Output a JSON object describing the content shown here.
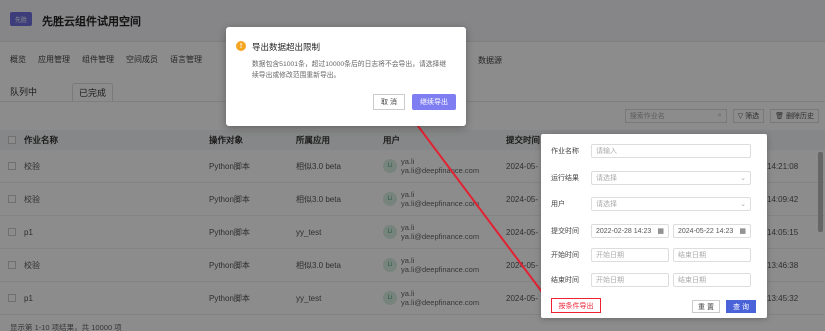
{
  "app": {
    "logo": "先胜",
    "title": "先胜云组件试用空间"
  },
  "menu": [
    "概览",
    "应用管理",
    "组件管理",
    "空间成员",
    "语言管理"
  ],
  "menu_extra": "数据源",
  "subtabs": [
    "队列中",
    "已完成"
  ],
  "toolbar": {
    "search_placeholder": "搜索作业名",
    "filter": "筛选",
    "delete_history": "删除历史"
  },
  "table": {
    "headers": [
      "作业名称",
      "操作对象",
      "所属应用",
      "用户",
      "提交时间"
    ],
    "rows": [
      {
        "name": "校验",
        "object": "Python脚本",
        "app": "相似3.0 beta",
        "user": "ya.li",
        "email": "ya.li@deepfinance.com",
        "date": "2024-05-",
        "time": "14:21:08"
      },
      {
        "name": "校验",
        "object": "Python脚本",
        "app": "相似3.0 beta",
        "user": "ya.li",
        "email": "ya.li@deepfinance.com",
        "date": "2024-05-",
        "time": "14:09:42"
      },
      {
        "name": "p1",
        "object": "Python脚本",
        "app": "yy_test",
        "user": "ya.li",
        "email": "ya.li@deepfinance.com",
        "date": "2024-05-",
        "time": "14:05:15"
      },
      {
        "name": "校验",
        "object": "Python脚本",
        "app": "相似3.0 beta",
        "user": "ya.li",
        "email": "ya.li@deepfinance.com",
        "date": "2024-05-",
        "time": "13:46:38"
      },
      {
        "name": "p1",
        "object": "Python脚本",
        "app": "yy_test",
        "user": "ya.li",
        "email": "ya.li@deepfinance.com",
        "date": "2024-05-",
        "time": "13:45:32"
      }
    ],
    "avatar_text": "Li"
  },
  "footer": "显示第 1-10 项结果，共 10000 项",
  "modal": {
    "title": "导出数据超出限制",
    "body": "数据包含51001条，超过10000条后的日志将不会导出，请选择继续导出或修改范围重新导出。",
    "cancel": "取 消",
    "confirm": "继续导出"
  },
  "filter_panel": {
    "job_name_label": "作业名称",
    "job_name_placeholder": "请输入",
    "result_label": "运行结果",
    "result_placeholder": "请选择",
    "user_label": "用户",
    "user_placeholder": "请选择",
    "submit_label": "提交时间",
    "submit_from": "2022-02-28 14:23",
    "submit_to": "2024-05-22 14:23",
    "start_label": "开始时间",
    "start_from_ph": "开始日期",
    "start_to_ph": "结束日期",
    "end_label": "结束时间",
    "end_from_ph": "开始日期",
    "end_to_ph": "结束日期",
    "export_by_condition": "按条件导出",
    "reset": "重 置",
    "query": "查 询"
  },
  "colors": {
    "primary": "#7e7ef2",
    "query": "#4b63d8",
    "highlight": "#e22233"
  }
}
